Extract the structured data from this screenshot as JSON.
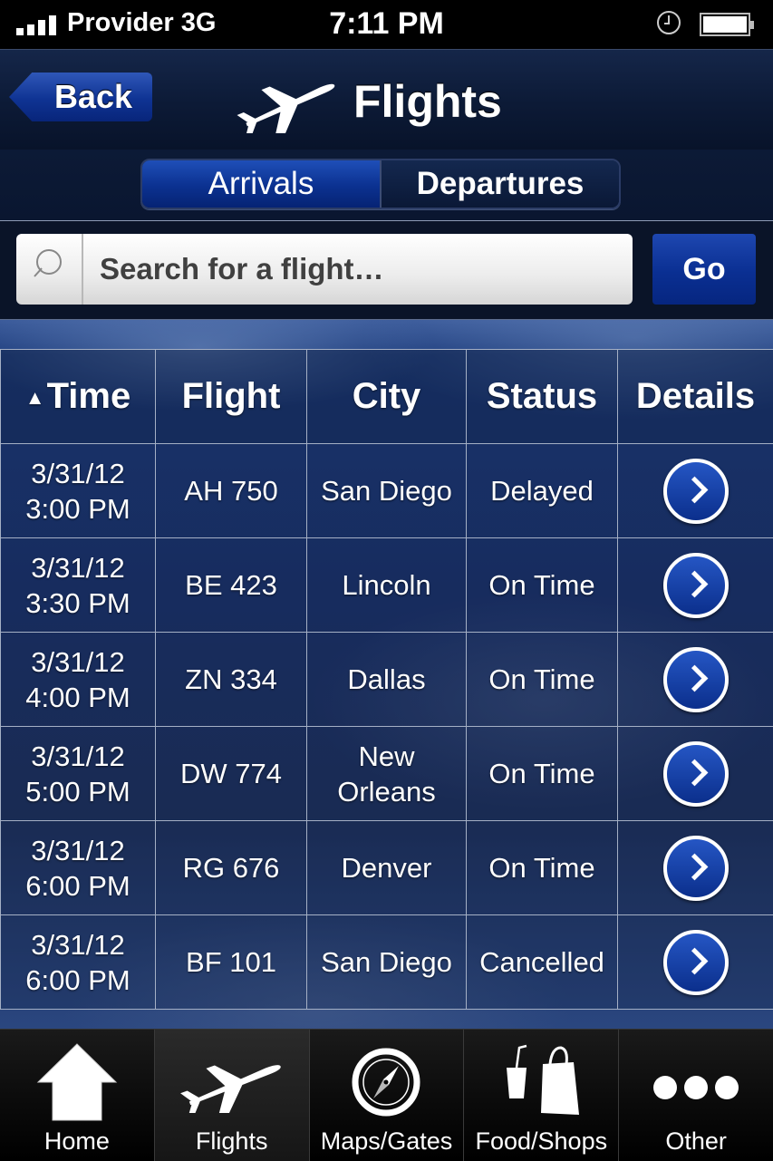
{
  "status_bar": {
    "carrier": "Provider 3G",
    "time": "7:11 PM"
  },
  "nav": {
    "back_label": "Back",
    "title": "Flights"
  },
  "segments": {
    "arrivals": "Arrivals",
    "departures": "Departures",
    "selected": "Arrivals"
  },
  "search": {
    "placeholder": "Search for a flight…",
    "go_label": "Go"
  },
  "table": {
    "headers": {
      "time": "Time",
      "flight": "Flight",
      "city": "City",
      "status": "Status",
      "details": "Details"
    },
    "sort_indicator": "▲",
    "rows": [
      {
        "date": "3/31/12",
        "time": "3:00 PM",
        "flight": "AH 750",
        "city": "San Diego",
        "status": "Delayed"
      },
      {
        "date": "3/31/12",
        "time": "3:30 PM",
        "flight": "BE 423",
        "city": "Lincoln",
        "status": "On Time"
      },
      {
        "date": "3/31/12",
        "time": "4:00 PM",
        "flight": "ZN 334",
        "city": "Dallas",
        "status": "On Time"
      },
      {
        "date": "3/31/12",
        "time": "5:00 PM",
        "flight": "DW 774",
        "city": "New Orleans",
        "status": "On Time"
      },
      {
        "date": "3/31/12",
        "time": "6:00 PM",
        "flight": "RG 676",
        "city": "Denver",
        "status": "On Time"
      },
      {
        "date": "3/31/12",
        "time": "6:00 PM",
        "flight": "BF 101",
        "city": "San Diego",
        "status": "Cancelled"
      }
    ]
  },
  "tabs": [
    {
      "label": "Home",
      "icon": "home-icon"
    },
    {
      "label": "Flights",
      "icon": "airplane-icon"
    },
    {
      "label": "Maps/Gates",
      "icon": "compass-icon"
    },
    {
      "label": "Food/Shops",
      "icon": "food-shops-icon"
    },
    {
      "label": "Other",
      "icon": "more-icon"
    }
  ],
  "active_tab": "Flights",
  "colors": {
    "accent_blue": "#0b3190",
    "background": "#0b1730"
  }
}
